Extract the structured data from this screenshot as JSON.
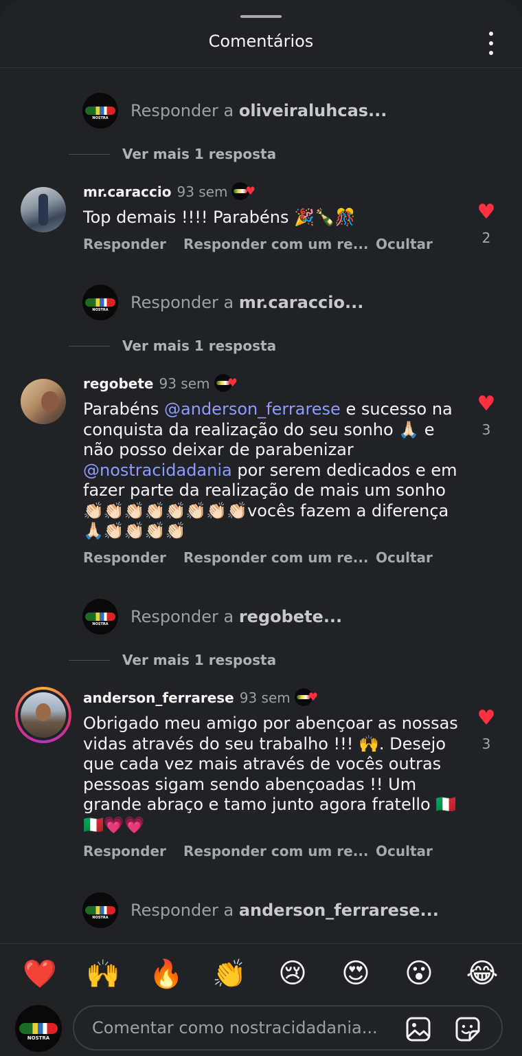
{
  "header": {
    "title": "Comentários"
  },
  "reply_prefix": "Responder a ",
  "view_more": "Ver mais 1 resposta",
  "reply_prompts": [
    {
      "user": "oliveiraluhcas..."
    },
    {
      "user": "mr.caraccio..."
    },
    {
      "user": "regobete..."
    },
    {
      "user": "anderson_ferrarese..."
    }
  ],
  "actions": {
    "reply": "Responder",
    "reply_with": "Responder com um re...",
    "hide": "Ocultar"
  },
  "comments": [
    {
      "user": "mr.caraccio",
      "time": "93 sem",
      "text": "Top demais !!!! Parabéns 🎉🍾🎊",
      "likes": "2"
    },
    {
      "user": "regobete",
      "time": "93 sem",
      "text_1": "Parabéns ",
      "mention_1": "@anderson_ferrarese",
      "text_2": " e sucesso na conquista da realização do seu sonho 🙏🏻 e não posso deixar de parabenizar ",
      "mention_2": "@nostracidadania",
      "text_3": " por serem dedicados e em fazer parte da realização de mais um sonho 👏🏻👏🏻👏🏻👏🏻👏🏻👏🏻👏🏻👏🏻vocês fazem a diferença 🙏🏻👏🏻👏🏻👏🏻👏🏻",
      "likes": "3"
    },
    {
      "user": "anderson_ferrarese",
      "time": "93 sem",
      "text": "Obrigado meu amigo por abençoar as nossas vidas através do seu trabalho !!! 🙌. Desejo que cada vez mais através de vocês outras pessoas sigam sendo abençoadas !! Um grande abraço e tamo junto agora fratello 🇮🇹🇮🇹💗💗",
      "likes": "3"
    }
  ],
  "logo_text": "NOSTRA",
  "quick_emojis": [
    "❤️",
    "🙌",
    "🔥",
    "👏",
    "😢",
    "😍",
    "😮",
    "😂"
  ],
  "composer": {
    "placeholder": "Comentar como nostracidadania..."
  },
  "colors": {
    "background": "#202226",
    "like_red": "#ff3040",
    "mention": "#8c9bff"
  }
}
